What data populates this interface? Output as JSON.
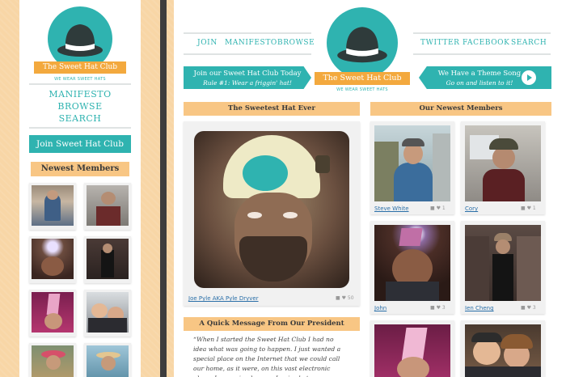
{
  "brand": {
    "name": "The Sweet Hat Club",
    "tagline": "WE WEAR SWEET HATS"
  },
  "mobile": {
    "nav": [
      "MANIFESTO",
      "BROWSE",
      "SEARCH"
    ],
    "join_label": "Join Sweet Hat Club",
    "members_heading": "Newest Members"
  },
  "desktop": {
    "nav_left": [
      "JOIN",
      "MANIFESTO",
      "BROWSE"
    ],
    "nav_right": [
      "TWITTER",
      "FACEBOOK",
      "SEARCH"
    ],
    "join_banner": {
      "title": "Join our Sweet Hat Club Today",
      "subtitle": "Rule #1: Wear a friggin' hat!"
    },
    "theme_banner": {
      "title": "We Have a Theme Song",
      "subtitle": "Go on and listen to it!"
    },
    "sweetest_heading": "The Sweetest Hat Ever",
    "featured": {
      "caption": "Joe Pyle AKA Pyle Dryver",
      "likes": "50"
    },
    "president_heading": "A Quick Message From Our President",
    "president_message": "“When I started the Sweet Hat Club I had no idea what was going to happen. I just wanted a special place on the Internet that we could call our home, as it were, on this vast electronic plane. I am a simple man. I enjoy hats.",
    "newest_heading": "Our Newest Members",
    "members": [
      {
        "name": "Steve White",
        "comments": "",
        "likes": "1"
      },
      {
        "name": "Cory",
        "comments": "",
        "likes": "1"
      },
      {
        "name": "John",
        "comments": "",
        "likes": "3"
      },
      {
        "name": "Ien Cheng",
        "comments": "",
        "likes": "3"
      }
    ]
  },
  "colors": {
    "accent": "#2fb3b0",
    "ribbon": "#f3a93e",
    "heading_bg": "#f8c684",
    "page_bg": "#f8d6a6"
  },
  "icons": [
    "hat-logo-icon",
    "comment-icon",
    "heart-icon",
    "play-icon"
  ]
}
